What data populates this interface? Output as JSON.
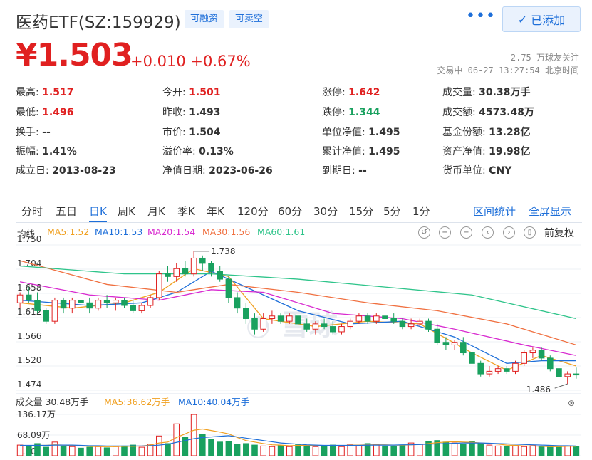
{
  "header": {
    "title": "医药ETF(SZ:159929)",
    "tags": [
      "可融资",
      "可卖空"
    ],
    "more_label": "•••",
    "add_label": "已添加"
  },
  "quote": {
    "price": "¥1.503",
    "change": "+0.010 +0.67%",
    "followers": "2.75 万球友关注",
    "status": "交易中 06-27 13:27:54 北京时间"
  },
  "stats": [
    [
      {
        "k": "最高:",
        "v": "1.517",
        "c": "red"
      },
      {
        "k": "今开:",
        "v": "1.501",
        "c": "red"
      },
      {
        "k": "涨停:",
        "v": "1.642",
        "c": "red"
      },
      {
        "k": "成交量:",
        "v": "30.38万手",
        "c": ""
      }
    ],
    [
      {
        "k": "最低:",
        "v": "1.496",
        "c": "red"
      },
      {
        "k": "昨收:",
        "v": "1.493",
        "c": ""
      },
      {
        "k": "跌停:",
        "v": "1.344",
        "c": "green"
      },
      {
        "k": "成交额:",
        "v": "4573.48万",
        "c": ""
      }
    ],
    [
      {
        "k": "换手:",
        "v": "--",
        "c": ""
      },
      {
        "k": "市价:",
        "v": "1.504",
        "c": ""
      },
      {
        "k": "单位净值:",
        "v": "1.495",
        "c": ""
      },
      {
        "k": "基金份额:",
        "v": "13.28亿",
        "c": ""
      }
    ],
    [
      {
        "k": "振幅:",
        "v": "1.41%",
        "c": ""
      },
      {
        "k": "溢价率:",
        "v": "0.13%",
        "c": ""
      },
      {
        "k": "累计净值:",
        "v": "1.495",
        "c": ""
      },
      {
        "k": "资产净值:",
        "v": "19.98亿",
        "c": ""
      }
    ],
    [
      {
        "k": "成立日:",
        "v": "2013-08-23",
        "c": ""
      },
      {
        "k": "净值日期:",
        "v": "2023-06-26",
        "c": ""
      },
      {
        "k": "到期日:",
        "v": "--",
        "c": ""
      },
      {
        "k": "货币单位:",
        "v": "CNY",
        "c": ""
      }
    ]
  ],
  "tabs": [
    "分时",
    "五日",
    "日K",
    "周K",
    "月K",
    "季K",
    "年K",
    "120分",
    "60分",
    "30分",
    "15分",
    "5分",
    "1分"
  ],
  "active_tab": "日K",
  "right_tabs": [
    "区间统计",
    "全屏显示"
  ],
  "ma_legend": [
    {
      "label": "均线",
      "color": "#333333"
    },
    {
      "label": "MA5:1.52",
      "color": "#f0a020"
    },
    {
      "label": "MA10:1.53",
      "color": "#1e6fd9"
    },
    {
      "label": "MA20:1.54",
      "color": "#d82ad0"
    },
    {
      "label": "MA30:1.56",
      "color": "#f07040"
    },
    {
      "label": "MA60:1.61",
      "color": "#2ec48a"
    }
  ],
  "controls": [
    "↺",
    "+",
    "−",
    "‹",
    "›",
    "▯"
  ],
  "fq_label": "前复权",
  "colors": {
    "up": "#e02020",
    "down": "#19a15f",
    "accent": "#1e6fd9"
  },
  "chart_data": {
    "type": "candlestick",
    "yticks": [
      "1.750",
      "1.704",
      "1.658",
      "1.612",
      "1.566",
      "1.520",
      "1.474"
    ],
    "ylim": [
      1.474,
      1.75
    ],
    "max_label": "1.738",
    "min_label": "1.486",
    "watermark": "雪球",
    "candles": [
      [
        1.64,
        1.66,
        1.63,
        1.655
      ],
      [
        1.655,
        1.67,
        1.64,
        1.645
      ],
      [
        1.645,
        1.66,
        1.62,
        1.625
      ],
      [
        1.625,
        1.63,
        1.6,
        1.605
      ],
      [
        1.605,
        1.65,
        1.6,
        1.645
      ],
      [
        1.645,
        1.65,
        1.62,
        1.63
      ],
      [
        1.63,
        1.65,
        1.62,
        1.645
      ],
      [
        1.645,
        1.655,
        1.635,
        1.64
      ],
      [
        1.64,
        1.65,
        1.62,
        1.63
      ],
      [
        1.63,
        1.65,
        1.625,
        1.645
      ],
      [
        1.645,
        1.655,
        1.63,
        1.64
      ],
      [
        1.64,
        1.65,
        1.625,
        1.645
      ],
      [
        1.645,
        1.65,
        1.63,
        1.635
      ],
      [
        1.635,
        1.645,
        1.62,
        1.625
      ],
      [
        1.625,
        1.64,
        1.62,
        1.635
      ],
      [
        1.635,
        1.655,
        1.63,
        1.65
      ],
      [
        1.65,
        1.7,
        1.645,
        1.695
      ],
      [
        1.695,
        1.71,
        1.68,
        1.69
      ],
      [
        1.69,
        1.715,
        1.68,
        1.705
      ],
      [
        1.705,
        1.72,
        1.69,
        1.695
      ],
      [
        1.695,
        1.738,
        1.69,
        1.725
      ],
      [
        1.725,
        1.73,
        1.7,
        1.715
      ],
      [
        1.715,
        1.72,
        1.69,
        1.7
      ],
      [
        1.7,
        1.71,
        1.68,
        1.685
      ],
      [
        1.685,
        1.69,
        1.64,
        1.65
      ],
      [
        1.65,
        1.66,
        1.62,
        1.63
      ],
      [
        1.63,
        1.64,
        1.6,
        1.61
      ],
      [
        1.61,
        1.62,
        1.58,
        1.59
      ],
      [
        1.59,
        1.62,
        1.585,
        1.61
      ],
      [
        1.61,
        1.625,
        1.6,
        1.615
      ],
      [
        1.615,
        1.62,
        1.6,
        1.605
      ],
      [
        1.605,
        1.62,
        1.6,
        1.615
      ],
      [
        1.615,
        1.62,
        1.59,
        1.6
      ],
      [
        1.6,
        1.61,
        1.585,
        1.59
      ],
      [
        1.59,
        1.605,
        1.58,
        1.6
      ],
      [
        1.6,
        1.61,
        1.59,
        1.595
      ],
      [
        1.595,
        1.605,
        1.58,
        1.585
      ],
      [
        1.585,
        1.6,
        1.58,
        1.595
      ],
      [
        1.595,
        1.61,
        1.59,
        1.605
      ],
      [
        1.605,
        1.62,
        1.6,
        1.615
      ],
      [
        1.615,
        1.62,
        1.6,
        1.605
      ],
      [
        1.605,
        1.62,
        1.6,
        1.615
      ],
      [
        1.615,
        1.625,
        1.605,
        1.61
      ],
      [
        1.61,
        1.62,
        1.6,
        1.605
      ],
      [
        1.605,
        1.61,
        1.59,
        1.595
      ],
      [
        1.595,
        1.61,
        1.59,
        1.6
      ],
      [
        1.6,
        1.61,
        1.595,
        1.605
      ],
      [
        1.605,
        1.61,
        1.585,
        1.59
      ],
      [
        1.59,
        1.6,
        1.56,
        1.565
      ],
      [
        1.565,
        1.575,
        1.55,
        1.56
      ],
      [
        1.56,
        1.57,
        1.55,
        1.565
      ],
      [
        1.565,
        1.575,
        1.54,
        1.545
      ],
      [
        1.545,
        1.55,
        1.52,
        1.525
      ],
      [
        1.525,
        1.53,
        1.5,
        1.505
      ],
      [
        1.505,
        1.52,
        1.5,
        1.51
      ],
      [
        1.51,
        1.52,
        1.505,
        1.515
      ],
      [
        1.515,
        1.52,
        1.505,
        1.51
      ],
      [
        1.51,
        1.53,
        1.505,
        1.525
      ],
      [
        1.525,
        1.55,
        1.52,
        1.545
      ],
      [
        1.545,
        1.555,
        1.535,
        1.55
      ],
      [
        1.55,
        1.555,
        1.53,
        1.535
      ],
      [
        1.535,
        1.54,
        1.51,
        1.515
      ],
      [
        1.515,
        1.52,
        1.495,
        1.5
      ],
      [
        1.5,
        1.51,
        1.486,
        1.505
      ],
      [
        1.505,
        1.517,
        1.496,
        1.503
      ]
    ],
    "ma": [
      {
        "name": "MA5",
        "color": "#f0a020",
        "points": [
          [
            0,
            1.64
          ],
          [
            6,
            1.63
          ],
          [
            12,
            1.64
          ],
          [
            16,
            1.66
          ],
          [
            20,
            1.705
          ],
          [
            24,
            1.69
          ],
          [
            28,
            1.61
          ],
          [
            34,
            1.595
          ],
          [
            40,
            1.605
          ],
          [
            46,
            1.6
          ],
          [
            52,
            1.545
          ],
          [
            56,
            1.512
          ],
          [
            60,
            1.54
          ],
          [
            64,
            1.52
          ]
        ]
      },
      {
        "name": "MA10",
        "color": "#1e6fd9",
        "points": [
          [
            0,
            1.645
          ],
          [
            8,
            1.635
          ],
          [
            14,
            1.64
          ],
          [
            18,
            1.66
          ],
          [
            22,
            1.7
          ],
          [
            26,
            1.67
          ],
          [
            32,
            1.625
          ],
          [
            38,
            1.6
          ],
          [
            44,
            1.605
          ],
          [
            50,
            1.575
          ],
          [
            56,
            1.525
          ],
          [
            60,
            1.53
          ],
          [
            64,
            1.53
          ]
        ]
      },
      {
        "name": "MA20",
        "color": "#d82ad0",
        "points": [
          [
            0,
            1.68
          ],
          [
            8,
            1.655
          ],
          [
            16,
            1.645
          ],
          [
            22,
            1.665
          ],
          [
            28,
            1.66
          ],
          [
            36,
            1.62
          ],
          [
            44,
            1.61
          ],
          [
            50,
            1.59
          ],
          [
            58,
            1.56
          ],
          [
            64,
            1.54
          ]
        ]
      },
      {
        "name": "MA30",
        "color": "#f07040",
        "points": [
          [
            0,
            1.72
          ],
          [
            10,
            1.675
          ],
          [
            18,
            1.66
          ],
          [
            24,
            1.675
          ],
          [
            32,
            1.66
          ],
          [
            40,
            1.64
          ],
          [
            48,
            1.625
          ],
          [
            56,
            1.6
          ],
          [
            64,
            1.56
          ]
        ]
      },
      {
        "name": "MA60",
        "color": "#2ec48a",
        "points": [
          [
            0,
            1.71
          ],
          [
            12,
            1.695
          ],
          [
            22,
            1.695
          ],
          [
            32,
            1.685
          ],
          [
            42,
            1.67
          ],
          [
            52,
            1.655
          ],
          [
            64,
            1.61
          ]
        ]
      }
    ],
    "volume": {
      "legend": [
        {
          "label": "成交量 30.48万手",
          "color": "#333333"
        },
        {
          "label": "MA5:36.62万手",
          "color": "#f0a020"
        },
        {
          "label": "MA10:40.04万手",
          "color": "#1e6fd9"
        }
      ],
      "yticks": [
        "136.17万",
        "68.09万",
        "0.00"
      ],
      "ylim": [
        0,
        136.17
      ],
      "values": [
        35,
        30,
        40,
        28,
        45,
        32,
        30,
        25,
        28,
        30,
        26,
        30,
        32,
        35,
        28,
        38,
        65,
        40,
        105,
        60,
        136,
        70,
        55,
        45,
        48,
        38,
        40,
        35,
        32,
        30,
        34,
        30,
        36,
        33,
        30,
        32,
        35,
        30,
        38,
        34,
        40,
        36,
        32,
        30,
        35,
        42,
        38,
        48,
        50,
        45,
        42,
        38,
        46,
        40,
        35,
        32,
        30,
        34,
        30,
        33,
        30,
        28,
        30,
        32,
        30
      ],
      "ma5": [
        33,
        33,
        34,
        34,
        36,
        35,
        34,
        32,
        31,
        30,
        30,
        30,
        31,
        31,
        32,
        35,
        42,
        45,
        60,
        72,
        84,
        88,
        83,
        78,
        72,
        60,
        50,
        45,
        40,
        36,
        35,
        33,
        34,
        34,
        33,
        32,
        33,
        33,
        35,
        35,
        36,
        36,
        36,
        35,
        35,
        36,
        37,
        40,
        43,
        45,
        46,
        45,
        44,
        42,
        40,
        38,
        35,
        34,
        32,
        32,
        31,
        30,
        30,
        31,
        31
      ],
      "ma10": [
        34,
        34,
        34,
        34,
        35,
        35,
        35,
        34,
        33,
        33,
        32,
        32,
        32,
        32,
        32,
        33,
        35,
        38,
        44,
        50,
        56,
        60,
        62,
        64,
        66,
        62,
        58,
        54,
        50,
        46,
        42,
        40,
        38,
        36,
        35,
        34,
        34,
        34,
        34,
        34,
        35,
        35,
        35,
        35,
        36,
        36,
        37,
        38,
        39,
        40,
        41,
        42,
        42,
        42,
        41,
        40,
        39,
        38,
        37,
        36,
        35,
        34,
        33,
        33,
        32
      ]
    }
  }
}
